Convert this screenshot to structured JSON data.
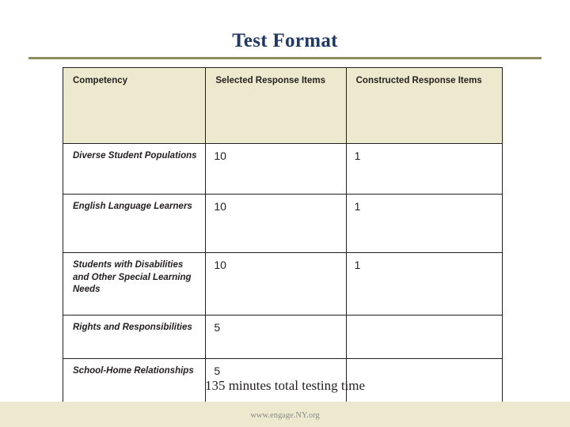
{
  "slide": {
    "title": "Test Format",
    "footnote": "135 minutes total testing time",
    "footer_url": "www.engage.NY.org",
    "accent_color": "#1F3864",
    "rule_color": "#8E8B5E",
    "header_fill": "#EDE9CE"
  },
  "table": {
    "headers": [
      "Competency",
      "Selected Response Items",
      "Constructed Response Items"
    ],
    "rows": [
      {
        "competency": "Diverse Student Populations",
        "selected": "10",
        "constructed": "1"
      },
      {
        "competency": "English Language Learners",
        "selected": "10",
        "constructed": "1"
      },
      {
        "competency": "Students with Disabilities and Other Special Learning Needs",
        "selected": "10",
        "constructed": "1"
      },
      {
        "competency": "Rights and Responsibilities",
        "selected": "5",
        "constructed": ""
      },
      {
        "competency": "School-Home Relationships",
        "selected": "5",
        "constructed": ""
      }
    ]
  }
}
